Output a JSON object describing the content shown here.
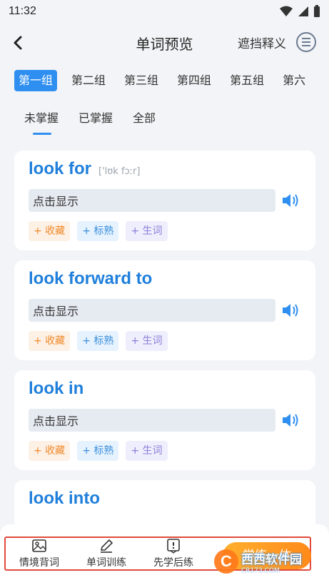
{
  "status": {
    "time": "11:32"
  },
  "header": {
    "title": "单词预览",
    "mask_label": "遮挡释义"
  },
  "groups": [
    "第一组",
    "第二组",
    "第三组",
    "第四组",
    "第五组",
    "第六"
  ],
  "subtabs": [
    "未掌握",
    "已掌握",
    "全部"
  ],
  "cards": [
    {
      "word": "look for",
      "phonetic": "['lʊk fɔːr]",
      "reveal": "点击显示"
    },
    {
      "word": "look forward to",
      "phonetic": "",
      "reveal": "点击显示"
    },
    {
      "word": "look in",
      "phonetic": "",
      "reveal": "点击显示"
    },
    {
      "word": "look into",
      "phonetic": "",
      "reveal": ""
    }
  ],
  "tags": {
    "fav": "+ 收藏",
    "known": "+ 标熟",
    "new": "+ 生词"
  },
  "bottom_nav": [
    "情境背词",
    "单词训练",
    "先学后练"
  ],
  "study_button": "学练一体",
  "watermark": {
    "title": "西西软件园",
    "sub": "CR173.COM"
  },
  "colors": {
    "accent": "#2f8ff0",
    "word": "#1f7fdb",
    "study_button": "#ff9a24",
    "highlight_border": "#e24a3b"
  }
}
